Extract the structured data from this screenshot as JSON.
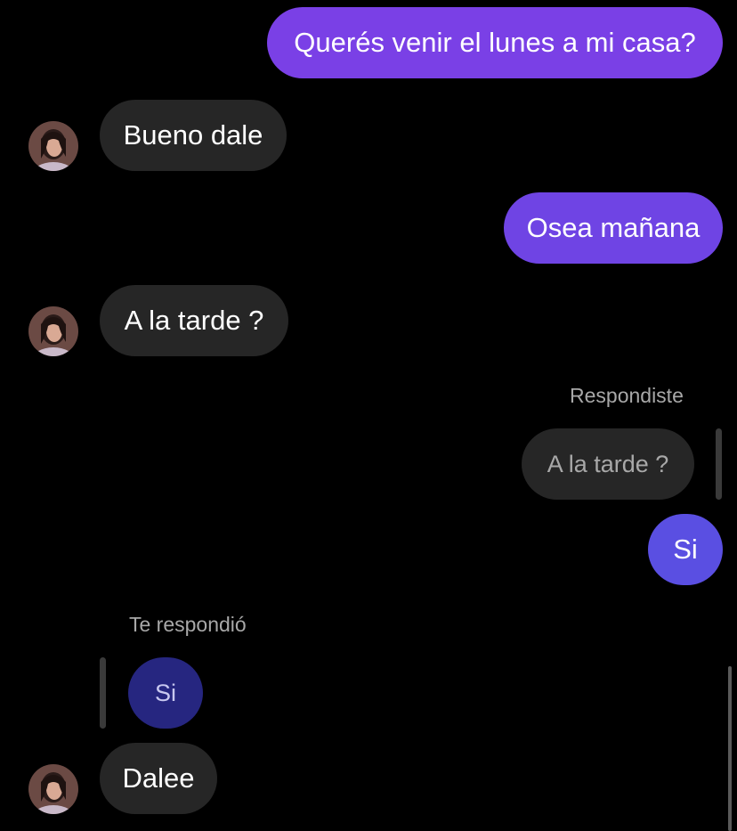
{
  "conversation": {
    "messages": [
      {
        "direction": "outgoing",
        "text": "Querés venir el lunes a mi casa?"
      },
      {
        "direction": "incoming",
        "text": "Bueno dale",
        "avatar": "contact-avatar"
      },
      {
        "direction": "outgoing",
        "text": "Osea mañana"
      },
      {
        "direction": "incoming",
        "text": "A la tarde ?",
        "avatar": "contact-avatar"
      },
      {
        "direction": "outgoing",
        "reply_label": "Respondiste",
        "quoted_text": "A la tarde ?",
        "text": "Si"
      },
      {
        "direction": "incoming",
        "reply_label": "Te respondió",
        "quoted_text": "Si",
        "text": "Dalee",
        "avatar": "contact-avatar"
      }
    ]
  },
  "colors": {
    "background": "#000000",
    "incoming_bubble": "#262626",
    "outgoing_gradient_top": "#7a3fe4",
    "outgoing_gradient_bottom": "#5b4fe0",
    "quoted_outgoing_bubble": "#262680",
    "secondary_text": "#a8a8a8"
  }
}
